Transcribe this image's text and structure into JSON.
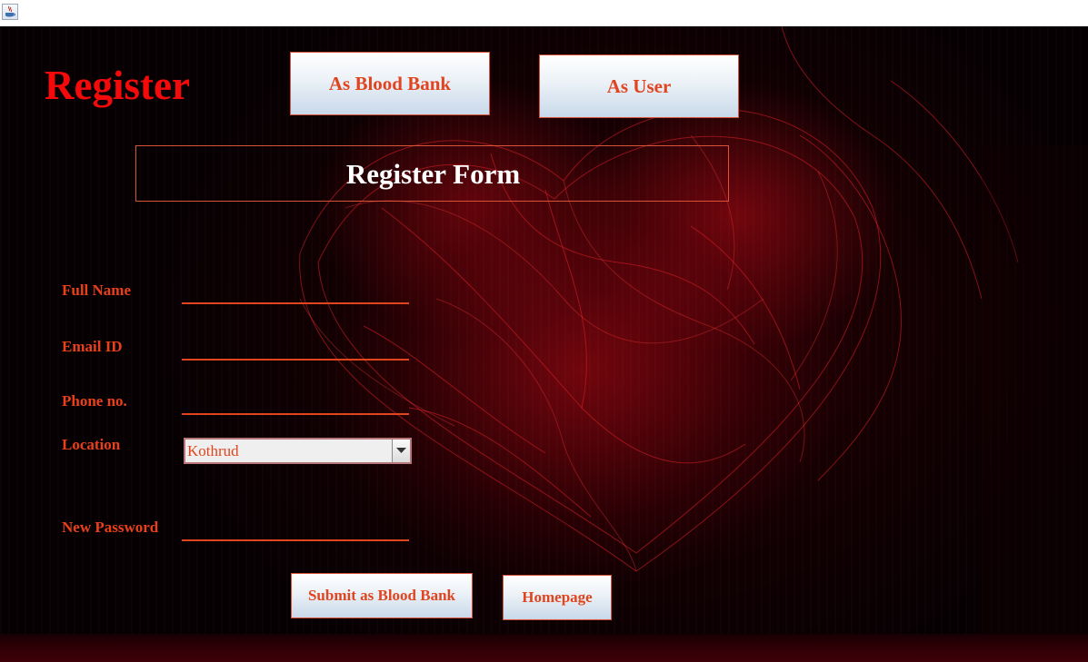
{
  "window": {
    "icon": "java-coffee-cup-icon"
  },
  "header": {
    "title": "Register",
    "as_blood_bank_label": "As Blood Bank",
    "as_user_label": "As User"
  },
  "form": {
    "title": "Register Form",
    "fields": {
      "full_name": {
        "label": "Full Name",
        "value": ""
      },
      "email": {
        "label": "Email ID",
        "value": ""
      },
      "phone": {
        "label": "Phone no.",
        "value": ""
      },
      "location": {
        "label": "Location",
        "value": "Kothrud"
      },
      "new_password": {
        "label": "New Password",
        "value": ""
      }
    },
    "submit_label": "Submit as Blood Bank",
    "homepage_label": "Homepage"
  },
  "colors": {
    "accent": "#e0451f",
    "heading": "#f40a0a",
    "title_text": "#ffffff",
    "background": "#050000"
  }
}
